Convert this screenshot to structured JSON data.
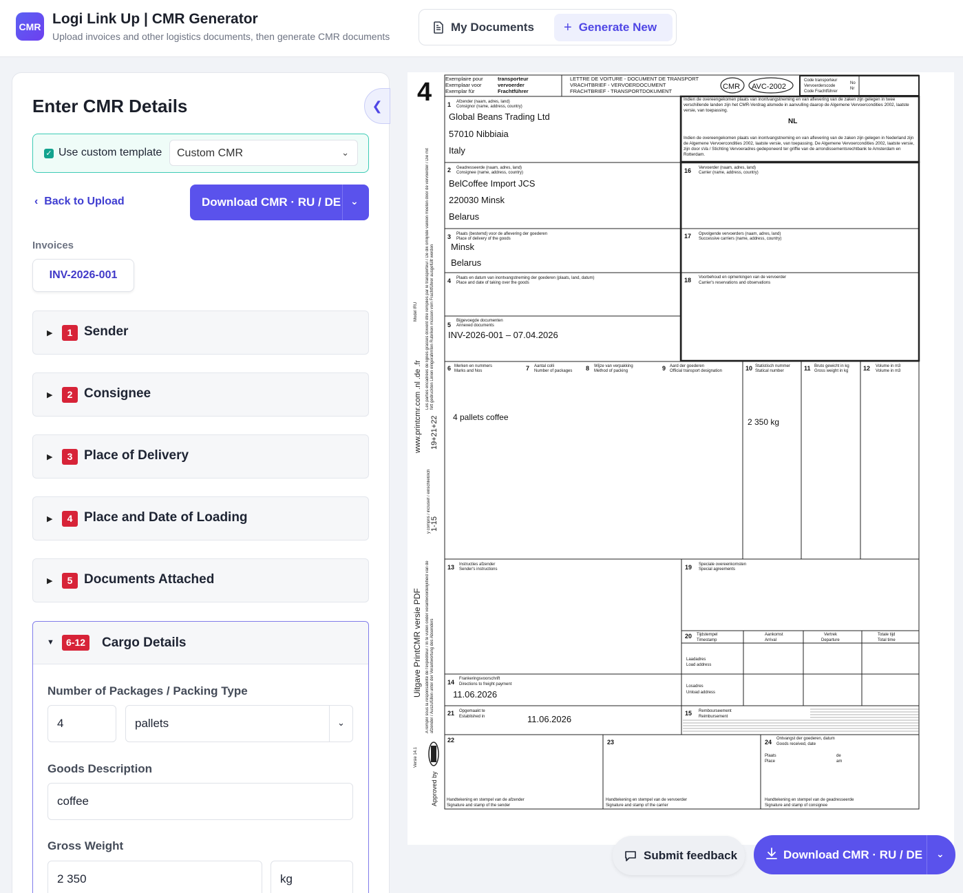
{
  "header": {
    "logo": "CMR",
    "title": "Logi Link Up | CMR Generator",
    "subtitle": "Upload invoices and other logistics documents, then generate CMR documents",
    "nav": {
      "my_documents": "My Documents",
      "generate_new": "Generate New"
    }
  },
  "form": {
    "heading": "Enter CMR Details",
    "template": {
      "checkbox_label": "Use custom template",
      "checked": true,
      "selected": "Custom CMR"
    },
    "back": "Back to Upload",
    "download": "Download CMR · RU / DE",
    "invoices_label": "Invoices",
    "invoice_chip": "INV-2026-001",
    "sections": [
      {
        "num": "1",
        "title": "Sender"
      },
      {
        "num": "2",
        "title": "Consignee"
      },
      {
        "num": "3",
        "title": "Place of Delivery"
      },
      {
        "num": "4",
        "title": "Place and Date of Loading"
      },
      {
        "num": "5",
        "title": "Documents Attached"
      }
    ],
    "cargo": {
      "num": "6-12",
      "title": "Cargo Details",
      "packages_label": "Number of Packages / Packing Type",
      "packages": "4",
      "packing_type": "pallets",
      "goods_label": "Goods Description",
      "goods": "coffee",
      "weight_label": "Gross Weight",
      "weight": "2 350",
      "unit": "kg"
    }
  },
  "cmr": {
    "copy_number": "4",
    "copy_labels": [
      "Exemplaire pour",
      "Exemplaar voor",
      "Exemplar für"
    ],
    "copy_for": [
      "transporteur",
      "vervoerder",
      "Frachtführer"
    ],
    "title_lines": [
      "LETTRE DE VOITURE - DOCUMENT DE TRANSPORT",
      "VRACHTBRIEF - VERVOERDOCUMENT",
      "FRACHTBRIEF - TRANSPORTDOKUMENT"
    ],
    "badge_cmr": "CMR",
    "badge_avc": "AVC-2002",
    "carrier_code": [
      "Code transporteur",
      "Vervoerderscode",
      "Code Frachtführer"
    ],
    "code_no": [
      "No",
      "Nr"
    ],
    "nl": "NL",
    "clause_1": "Indien de overeengekomen plaats van inontvangstneming en van aflevering van de zaken zijn gelegen in twee verschillende landen zijn het CMR-Verdrag alsmede in aanvulling daarop de Algemene Vervoercondities 2002, laatste versie, van toepassing.",
    "clause_2": "Indien de overeengekomen plaats van inontvangstneming en van aflevering van de zaken zijn gelegen in Nederland zijn de Algemene Vervoercondities 2002, laatste versie, van toepassing. De Algemene Vervoercondities 2002, laatste versie, zijn door sVa / Stichting Vervoeradres gedeponeerd ter griffie van de arrondissementsrechtbank te Amsterdam en Rotterdam.",
    "f1": {
      "label": [
        "Afzender (naam, adres, land)",
        "Consignor (name, address, country)"
      ],
      "lines": [
        "Global Beans Trading Ltd",
        "57010 Nibbiaia",
        "Italy"
      ]
    },
    "f2": {
      "label": [
        "Geadresseerde (naam, adres, land)",
        "Consignee (name, address, country)"
      ],
      "lines": [
        "BelCoffee Import JCS",
        "220030 Minsk",
        "Belarus"
      ]
    },
    "f3": {
      "label": [
        "Plaats (bestemd) voor de aflevering der goederen",
        "Place of delivery of the goods"
      ],
      "lines": [
        "Minsk",
        "Belarus"
      ]
    },
    "f4": {
      "label": [
        "Plaats en datum van inontvangstneming der goederen (plaats, land, datum)",
        "Place and date of taking over the goods"
      ]
    },
    "f5": {
      "label": [
        "Bijgevoegde documenten",
        "Annexed documents"
      ],
      "value": "INV-2026-001 – 07.04.2026"
    },
    "f16": {
      "label": [
        "Vervoerder (naam, adres, land)",
        "Carrier (name, address, country)"
      ]
    },
    "f17": {
      "label": [
        "Opvolgende vervoerders (naam, adres, land)",
        "Successive carriers (name, address, country)"
      ]
    },
    "f18": {
      "label": [
        "Voorbehoud en opmerkingen van de vervoerder",
        "Carrier's reservations and observations"
      ]
    },
    "f6": {
      "label": [
        "Merken en nummers",
        "Marks and Nos"
      ]
    },
    "f7": {
      "label": [
        "Aantal colli",
        "Number of packages"
      ]
    },
    "f8": {
      "label": [
        "Wijze van verpakking",
        "Method of packing"
      ]
    },
    "f9": {
      "label": [
        "Aard der goederen",
        "Official transport designation"
      ]
    },
    "f10": {
      "label": [
        "Statistisch nummer",
        "Statical number"
      ]
    },
    "f11": {
      "label": [
        "Bruto gewicht in kg",
        "Gross weight in kg"
      ]
    },
    "f12": {
      "label": [
        "Volume in m3",
        "Volume in m3"
      ]
    },
    "goods_line": "4 pallets coffee",
    "weight_line": "2 350 kg",
    "f13": {
      "label": [
        "Instructies afzender",
        "Sender's instructions"
      ]
    },
    "f19": {
      "label": [
        "Speciale overeenkomsten",
        "Special agreements"
      ]
    },
    "f20": {
      "label": [
        "Tijdstempel",
        "Timestamp"
      ],
      "cols": [
        "Aankomst",
        "Arrival",
        "Vertrek",
        "Departure",
        "Totale tijd",
        "Total time"
      ],
      "load": [
        "Laadadres",
        "Load address"
      ],
      "unload": [
        "Losadres",
        "Unload address"
      ]
    },
    "f14": {
      "label": [
        "Frankeringsvoorschrift",
        "Directions to freight payment"
      ],
      "value": "11.06.2026"
    },
    "f21": {
      "label": [
        "Opgemaakt te",
        "Established in"
      ],
      "value": "11.06.2026"
    },
    "f15": {
      "label": [
        "Rembourseement",
        "Reimbursement"
      ]
    },
    "f22": {
      "sig": [
        "Handtekening en stempel van de afzender",
        "Signature and stamp of the sender"
      ]
    },
    "f23": {
      "sig": [
        "Handtekening en stempel van de vervoerder",
        "Signature and stamp of the carrier"
      ]
    },
    "f24": {
      "label": [
        "Ontvangst der goederen, datum",
        "Goods received, date"
      ],
      "place": [
        "Plaats",
        "Place"
      ],
      "de": [
        "de",
        "am"
      ],
      "sig": [
        "Handtekening en stempel van de geadresseerde",
        "Signature and stamp of consignee"
      ]
    },
    "side": {
      "model": "Model IRU",
      "url": "www.printcmr.com .nl .de .fr",
      "fields_a": "19+21+22",
      "fields_b": "1-15",
      "edition": "Uitgave PrintCMR versie PDF",
      "version": "Versie 14.1",
      "approved": "Approved by",
      "note_a": "Les parties encadrées de lignes grasses doivent être remplies par le transporteur / De dik omlijnde vakken moeten door de vervoerder / Die mit fett gedruckten Linien eingerahmten Rubriken müssen vom Frachtführer ausgefüllt werden",
      "note_b": "y compris / inclusief / einschließlich",
      "note_c": "A remplir sous la responsabilité de l'expéditeur / In te vullen onder verantwoordelijkheid van de afzender / Auszufüllen unter der Verantwortung des Absenders"
    }
  },
  "floating": {
    "feedback": "Submit feedback",
    "download": "Download CMR · RU / DE"
  },
  "colors": {
    "accent": "#5a52ec",
    "badge": "#d72338",
    "template_border": "#3ccbb5"
  }
}
